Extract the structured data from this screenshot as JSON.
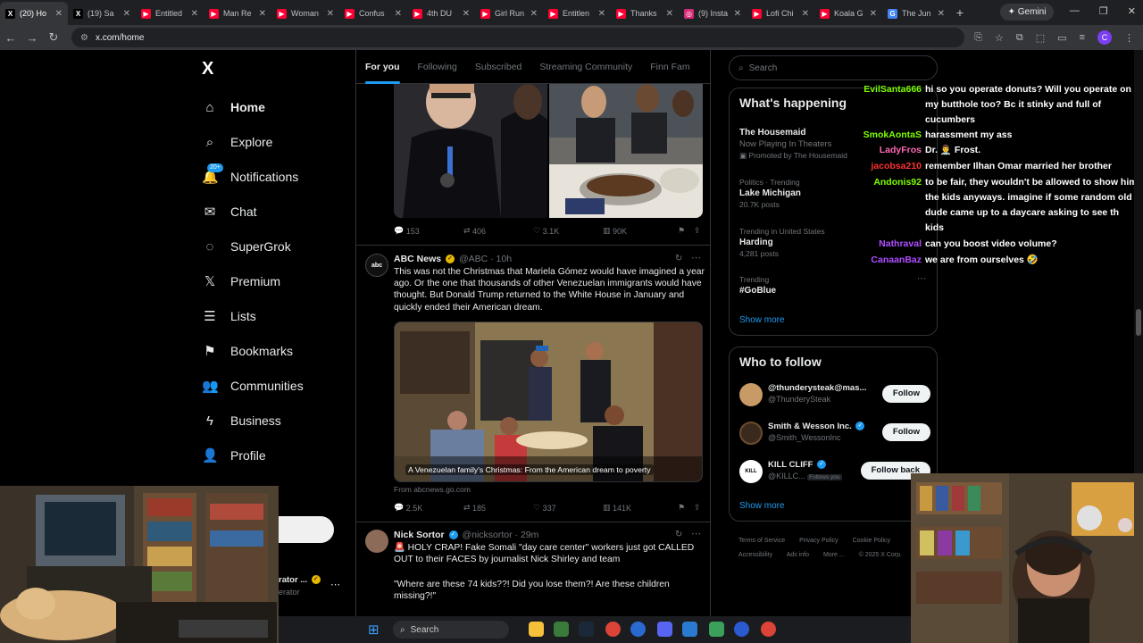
{
  "browser": {
    "tabs": [
      {
        "label": "(20) Ho",
        "active": true,
        "fav": "X",
        "color": "#000000"
      },
      {
        "label": "(19) Sa",
        "fav": "X",
        "color": "#000000"
      },
      {
        "label": "Entitled",
        "fav": "▶",
        "color": "#ff0033"
      },
      {
        "label": "Man Re",
        "fav": "▶",
        "color": "#ff0033"
      },
      {
        "label": "Woman",
        "fav": "▶",
        "color": "#ff0033"
      },
      {
        "label": "Confus",
        "fav": "▶",
        "color": "#ff0033"
      },
      {
        "label": "4th DU",
        "fav": "▶",
        "color": "#ff0033"
      },
      {
        "label": "Girl Run",
        "fav": "▶",
        "color": "#ff0033"
      },
      {
        "label": "Entitlen",
        "fav": "▶",
        "color": "#ff0033"
      },
      {
        "label": "Thanks",
        "fav": "▶",
        "color": "#ff0033"
      },
      {
        "label": "(9) Insta",
        "fav": "◎",
        "color": "#d62976"
      },
      {
        "label": "Lofi Chi",
        "fav": "▶",
        "color": "#ff0033"
      },
      {
        "label": "Koala G",
        "fav": "▶",
        "color": "#ff0033"
      },
      {
        "label": "The Jun",
        "fav": "G",
        "color": "#4285f4"
      }
    ],
    "new_tab": "+",
    "gemini_label": "Gemini",
    "url": "x.com/home",
    "profile_initial": "C"
  },
  "leftnav": {
    "logo": "X",
    "items": [
      {
        "label": "Home",
        "icon": "home-icon",
        "glyph": "⌂"
      },
      {
        "label": "Explore",
        "icon": "search-icon",
        "glyph": "⌕"
      },
      {
        "label": "Notifications",
        "icon": "bell-icon",
        "glyph": "🔔"
      },
      {
        "label": "Chat",
        "icon": "mail-icon",
        "glyph": "✉"
      },
      {
        "label": "SuperGrok",
        "icon": "grok-icon",
        "glyph": "◌"
      },
      {
        "label": "Premium",
        "icon": "x-premium-icon",
        "glyph": "𝕏"
      },
      {
        "label": "Lists",
        "icon": "list-icon",
        "glyph": "☰"
      },
      {
        "label": "Bookmarks",
        "icon": "bookmark-icon",
        "glyph": "⚑"
      },
      {
        "label": "Communities",
        "icon": "people-icon",
        "glyph": "👥"
      },
      {
        "label": "Business",
        "icon": "lightning-icon",
        "glyph": "ϟ"
      },
      {
        "label": "Profile",
        "icon": "person-icon",
        "glyph": "👤"
      },
      {
        "label": "More",
        "icon": "more-icon",
        "glyph": "⋯"
      }
    ],
    "notif_badge": "20+",
    "account_name_partial": "rator ...",
    "account_handle_partial": "erator"
  },
  "feed": {
    "tabs": [
      "For you",
      "Following",
      "Subscribed",
      "Streaming Community",
      "Finn Fam"
    ],
    "active_tab": "For you",
    "post1_actions": {
      "replies": "153",
      "reposts": "406",
      "likes": "3.1K",
      "views": "90K"
    },
    "post2": {
      "name": "ABC News",
      "handle": "@ABC",
      "time": "10h",
      "text": "This was not the Christmas that Mariela Gómez would have imagined a year ago. Or the one that thousands of other Venezuelan immigrants would have thought. But Donald Trump returned to the White House in January and quickly ended their American dream.",
      "card_caption": "A Venezuelan family's Christmas: From the American dream to poverty",
      "card_source": "From abcnews.go.com",
      "actions": {
        "replies": "2.5K",
        "reposts": "185",
        "likes": "337",
        "views": "141K"
      }
    },
    "post3": {
      "name": "Nick Sortor",
      "handle": "@nicksortor",
      "time": "29m",
      "text1": "🚨 HOLY CRAP! Fake Somali \"day care center\" workers just got CALLED OUT to their FACES by journalist Nick Shirley and team",
      "text2": "\"Where are these 74 kids??! Did you lose them?! Are these children missing?!\""
    }
  },
  "sidebar": {
    "search_placeholder": "Search",
    "happening_title": "What's happening",
    "trends": [
      {
        "context": "",
        "title": "The Housemaid",
        "sub": "Now Playing In Theaters",
        "promo": "Promoted by The Housemaid"
      },
      {
        "context": "Politics · Trending",
        "title": "Lake Michigan",
        "sub": "20.7K posts"
      },
      {
        "context": "Trending in United States",
        "title": "Harding",
        "sub": "4,281 posts"
      },
      {
        "context": "Trending",
        "title": "#GoBlue",
        "sub": ""
      }
    ],
    "show_more": "Show more",
    "follow_title": "Who to follow",
    "follow": [
      {
        "name": "@thunderysteak@mas...",
        "handle": "@ThunderySteak",
        "button": "Follow"
      },
      {
        "name": "Smith & Wesson Inc.",
        "handle": "@Smith_WessonInc",
        "button": "Follow"
      },
      {
        "name": "KILL CLIFF",
        "handle": "@KILLC...",
        "badge": "Follows you",
        "button": "Follow back"
      }
    ],
    "follow_show_more": "Show more",
    "footer": [
      "Terms of Service",
      "Privacy Policy",
      "Cookie Policy",
      "Accessibility",
      "Ads info",
      "More ...",
      "© 2025 X Corp."
    ]
  },
  "chat": [
    {
      "user": "EvilSanta666",
      "color": "#7fff00",
      "text": "hi so you operate donuts? Will you operate on my butthole too? Bc it stinky and full of cucumbers"
    },
    {
      "user": "SmokAontaS",
      "color": "#7fff00",
      "text": "harassment my ass"
    },
    {
      "user": "LadyFros",
      "color": "#ff69b4",
      "text": "Dr. 👨‍⚕️ Frost."
    },
    {
      "user": "jacobsa210",
      "color": "#ff3030",
      "text": "remember Ilhan Omar married her brother"
    },
    {
      "user": "Andonis92",
      "color": "#7fff00",
      "text": "to be fair, they wouldn't be allowed to show him the kids anyways. imagine if some random old dude came up to a daycare asking to see th kids"
    },
    {
      "user": "Nathraval",
      "color": "#b04dff",
      "text": "can you boost video volume?"
    },
    {
      "user": "CanaanBaz",
      "color": "#b04dff",
      "text": "we are from ourselves 🤣"
    }
  ],
  "taskbar": {
    "search": "Search"
  }
}
